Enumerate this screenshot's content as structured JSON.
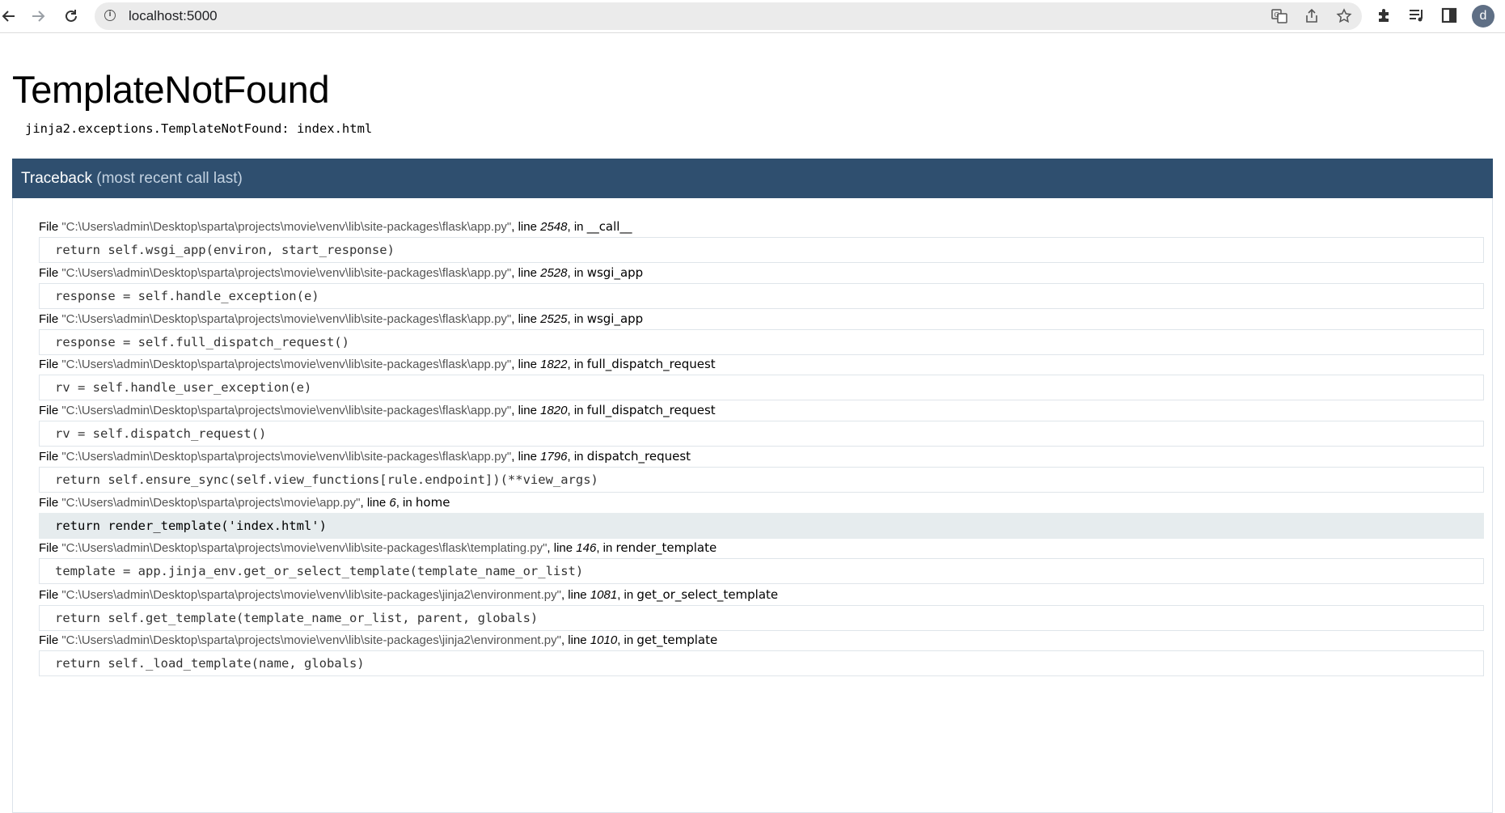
{
  "browser": {
    "url": "localhost:5000",
    "profile_initial": "d",
    "icons": [
      "back-icon",
      "forward-icon",
      "reload-icon",
      "info-icon",
      "translate-icon",
      "share-icon",
      "bookmark-star-icon",
      "extensions-icon",
      "reading-list-icon",
      "side-panel-icon"
    ]
  },
  "error": {
    "title": "TemplateNotFound",
    "message": "jinja2.exceptions.TemplateNotFound: index.html"
  },
  "traceback": {
    "title": "Traceback",
    "subtitle": "(most recent call last)",
    "file_label": "File",
    "line_label": "line",
    "in_label": "in",
    "frames": [
      {
        "file": "\"C:\\Users\\admin\\Desktop\\sparta\\projects\\movie\\venv\\lib\\site-packages\\flask\\app.py\"",
        "line": "2548",
        "func": "__call__",
        "code": "return self.wsgi_app(environ, start_response)",
        "current": false
      },
      {
        "file": "\"C:\\Users\\admin\\Desktop\\sparta\\projects\\movie\\venv\\lib\\site-packages\\flask\\app.py\"",
        "line": "2528",
        "func": "wsgi_app",
        "code": "response = self.handle_exception(e)",
        "current": false
      },
      {
        "file": "\"C:\\Users\\admin\\Desktop\\sparta\\projects\\movie\\venv\\lib\\site-packages\\flask\\app.py\"",
        "line": "2525",
        "func": "wsgi_app",
        "code": "response = self.full_dispatch_request()",
        "current": false
      },
      {
        "file": "\"C:\\Users\\admin\\Desktop\\sparta\\projects\\movie\\venv\\lib\\site-packages\\flask\\app.py\"",
        "line": "1822",
        "func": "full_dispatch_request",
        "code": "rv = self.handle_user_exception(e)",
        "current": false
      },
      {
        "file": "\"C:\\Users\\admin\\Desktop\\sparta\\projects\\movie\\venv\\lib\\site-packages\\flask\\app.py\"",
        "line": "1820",
        "func": "full_dispatch_request",
        "code": "rv = self.dispatch_request()",
        "current": false
      },
      {
        "file": "\"C:\\Users\\admin\\Desktop\\sparta\\projects\\movie\\venv\\lib\\site-packages\\flask\\app.py\"",
        "line": "1796",
        "func": "dispatch_request",
        "code": "return self.ensure_sync(self.view_functions[rule.endpoint])(**view_args)",
        "current": false
      },
      {
        "file": "\"C:\\Users\\admin\\Desktop\\sparta\\projects\\movie\\app.py\"",
        "line": "6",
        "func": "home",
        "code": "return render_template('index.html')",
        "current": true
      },
      {
        "file": "\"C:\\Users\\admin\\Desktop\\sparta\\projects\\movie\\venv\\lib\\site-packages\\flask\\templating.py\"",
        "line": "146",
        "func": "render_template",
        "code": "template = app.jinja_env.get_or_select_template(template_name_or_list)",
        "current": false
      },
      {
        "file": "\"C:\\Users\\admin\\Desktop\\sparta\\projects\\movie\\venv\\lib\\site-packages\\jinja2\\environment.py\"",
        "line": "1081",
        "func": "get_or_select_template",
        "code": "return self.get_template(template_name_or_list, parent, globals)",
        "current": false
      },
      {
        "file": "\"C:\\Users\\admin\\Desktop\\sparta\\projects\\movie\\venv\\lib\\site-packages\\jinja2\\environment.py\"",
        "line": "1010",
        "func": "get_template",
        "code": "return self._load_template(name, globals)",
        "current": false
      }
    ]
  }
}
